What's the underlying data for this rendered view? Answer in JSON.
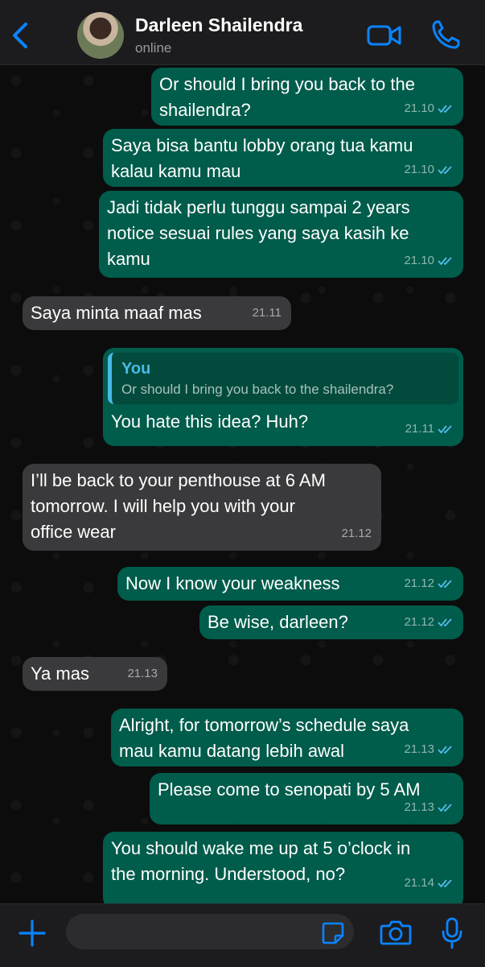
{
  "header": {
    "contact_name": "Darleen Shailendra",
    "status": "online"
  },
  "messages": [
    {
      "dir": "out",
      "text": "Or should I bring you back to the\nshailendra?",
      "time": "21.10",
      "read": true
    },
    {
      "dir": "out",
      "text": "Saya bisa bantu lobby orang tua kamu\nkalau kamu mau",
      "time": "21.10",
      "read": true
    },
    {
      "dir": "out",
      "text": "Jadi tidak perlu tunggu sampai 2 years\nnotice sesuai rules yang saya kasih ke\nkamu",
      "time": "21.10",
      "read": true
    },
    {
      "dir": "in",
      "text": "Saya minta maaf mas",
      "time": "21.11"
    },
    {
      "dir": "out",
      "quote_author": "You",
      "quote_text": "Or should I bring you back to the shailendra?",
      "text": "You hate this idea? Huh?",
      "time": "21.11",
      "read": true
    },
    {
      "dir": "in",
      "text": "I’ll be back to your penthouse at 6 AM\ntomorrow. I will help you with your\noffice wear",
      "time": "21.12"
    },
    {
      "dir": "out",
      "text": "Now I know your weakness",
      "time": "21.12",
      "read": true
    },
    {
      "dir": "out",
      "text": "Be wise, darleen?",
      "time": "21.12",
      "read": true
    },
    {
      "dir": "in",
      "text": "Ya mas",
      "time": "21.13"
    },
    {
      "dir": "out",
      "text": "Alright, for tomorrow’s schedule saya\nmau kamu datang lebih awal",
      "time": "21.13",
      "read": true
    },
    {
      "dir": "out",
      "text": "Please come to senopati by 5 AM",
      "time": "21.13",
      "read": true
    },
    {
      "dir": "out",
      "text": "You should wake me up at 5 o’clock in\nthe morning. Understood, no?",
      "time": "21.14",
      "read": true
    }
  ],
  "composer": {
    "value": "",
    "placeholder": ""
  },
  "colors": {
    "outgoing_bubble": "#005c4b",
    "incoming_bubble": "#3a3a3c",
    "accent": "#0a84ff",
    "quote_accent": "#49b9e6"
  },
  "icons": [
    "back-chevron-icon",
    "video-call-icon",
    "phone-icon",
    "plus-icon",
    "sticker-icon",
    "camera-icon",
    "microphone-icon",
    "read-ticks-icon"
  ]
}
